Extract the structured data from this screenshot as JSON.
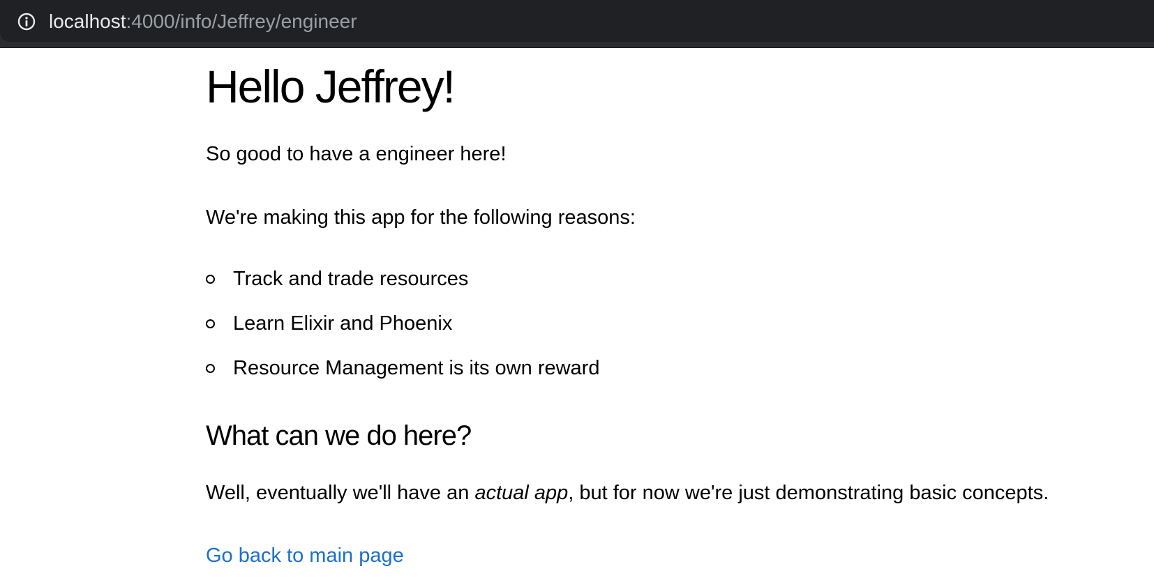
{
  "browser": {
    "url_host": "localhost",
    "url_path": ":4000/info/Jeffrey/engineer",
    "info_icon": "info-circle-icon"
  },
  "page": {
    "heading": "Hello Jeffrey!",
    "greeting": "So good to have a engineer here!",
    "reasons_intro": "We're making this app for the following reasons:",
    "reasons": [
      "Track and trade resources",
      "Learn Elixir and Phoenix",
      "Resource Management is its own reward"
    ],
    "subheading": "What can we do here?",
    "body_before": "Well, eventually we'll have an ",
    "body_emphasis": "actual app",
    "body_after": ", but for now we're just demonstrating basic concepts.",
    "back_link": "Go back to main page",
    "link_color": "#1a6fcf"
  }
}
